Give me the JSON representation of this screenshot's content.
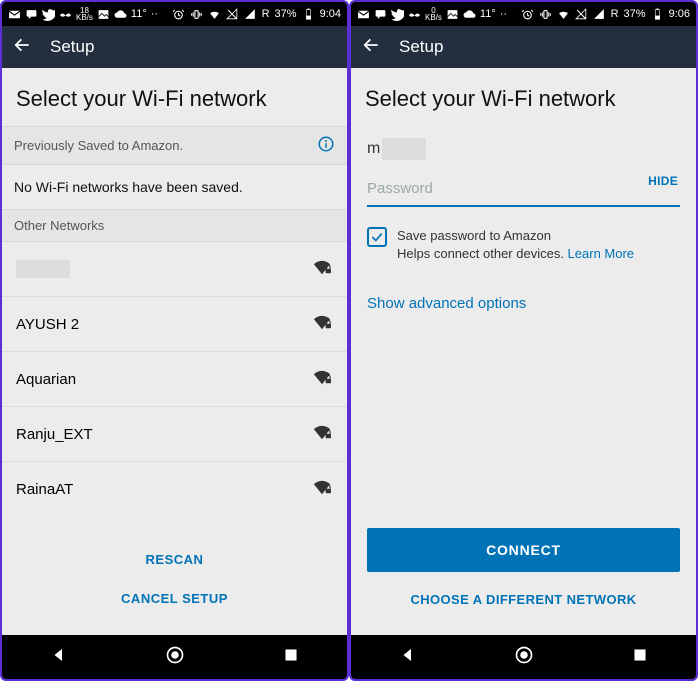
{
  "left": {
    "statusbar": {
      "kbps": "18",
      "temp": "11°",
      "roam": "R",
      "battery": "37%",
      "time": "9:04"
    },
    "header": {
      "title": "Setup"
    },
    "main": {
      "title": "Select your Wi-Fi network",
      "saved_header": "Previously Saved to Amazon.",
      "empty": "No Wi-Fi networks have been saved.",
      "other_header": "Other Networks",
      "networks": [
        {
          "name": ""
        },
        {
          "name": "AYUSH 2"
        },
        {
          "name": "Aquarian"
        },
        {
          "name": "Ranju_EXT"
        },
        {
          "name": "RainaAT"
        }
      ],
      "rescan": "RESCAN",
      "cancel": "CANCEL SETUP"
    }
  },
  "right": {
    "statusbar": {
      "kbps": "0",
      "temp": "11°",
      "roam": "R",
      "battery": "37%",
      "time": "9:06"
    },
    "header": {
      "title": "Setup"
    },
    "main": {
      "title": "Select your Wi-Fi network",
      "ssid_prefix": "m",
      "password_placeholder": "Password",
      "hide": "HIDE",
      "save_label": "Save password to Amazon",
      "save_sub": "Helps connect other devices. ",
      "learn_more": "Learn More",
      "advanced": "Show advanced options",
      "connect": "CONNECT",
      "choose": "CHOOSE A DIFFERENT NETWORK"
    }
  }
}
